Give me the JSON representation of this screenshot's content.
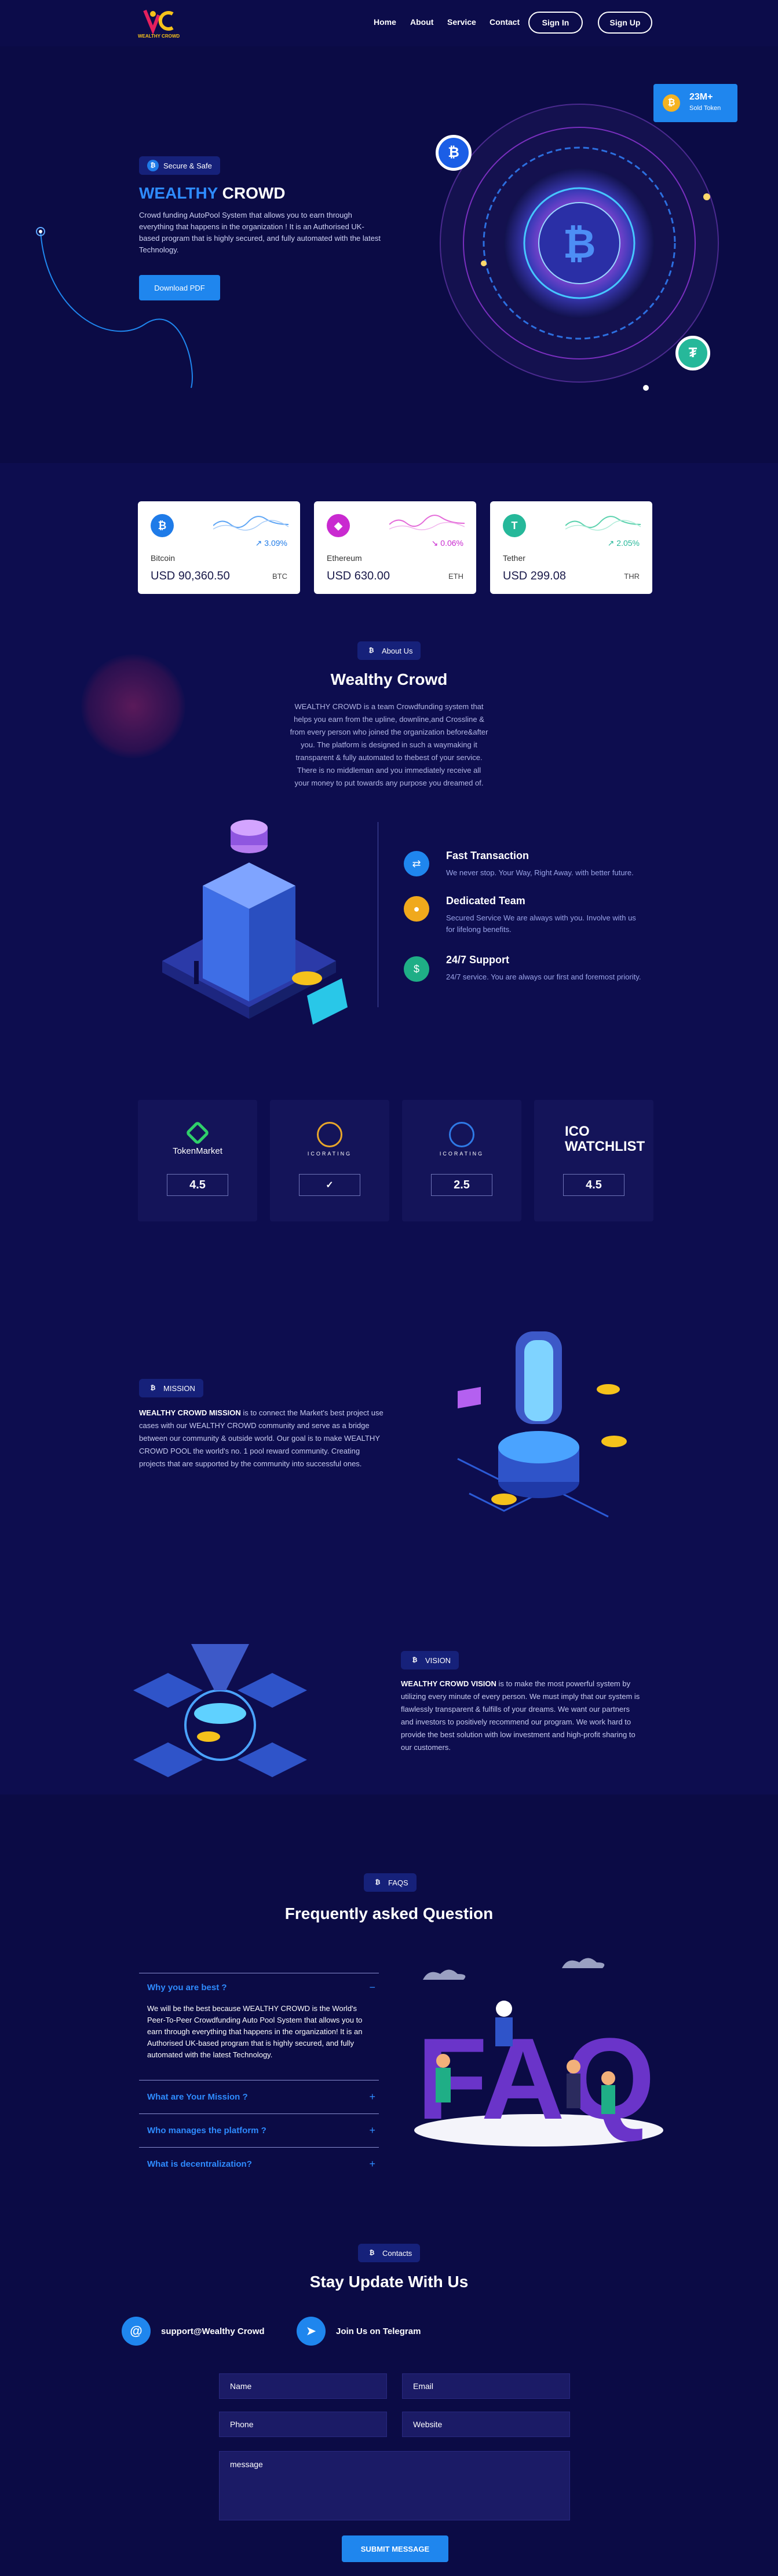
{
  "brand": {
    "logo_text": "WEALTHY CROWD"
  },
  "nav": {
    "links": [
      "Home",
      "About",
      "Service",
      "Contact"
    ],
    "signin": "Sign In",
    "signup": "Sign Up"
  },
  "hero": {
    "badge": "Secure & Safe",
    "title_accent": "WEALTHY",
    "title_rest": "CROWD",
    "description": "Crowd funding AutoPool System that allows you to earn through everything that happens in the organization ! It is an Authorised UK-based program that is highly secured, and fully automated with the latest Technology.",
    "download_button": "Download PDF",
    "sold_badge_value": "23M+",
    "sold_badge_label": "Sold Token"
  },
  "tickers": [
    {
      "name": "Bitcoin",
      "price": "USD 90,360.50",
      "symbol": "BTC",
      "change": "3.09%",
      "color": "#1f7be8",
      "glyph": "₿"
    },
    {
      "name": "Ethereum",
      "price": "USD 630.00",
      "symbol": "ETH",
      "change": "0.06%",
      "color": "#c92ad0",
      "glyph": "◆"
    },
    {
      "name": "Tether",
      "price": "USD 299.08",
      "symbol": "THR",
      "change": "2.05%",
      "color": "#26b89a",
      "glyph": "T"
    }
  ],
  "about": {
    "pill": "About Us",
    "title": "Wealthy Crowd",
    "text": "WEALTHY CROWD is a team Crowdfunding system that helps you earn from the upline, downline,and Crossline & from every person who joined the organization before&after you. The platform is designed in such a waymaking it transparent & fully automated to thebest of your service. There is no middleman and you immediately receive all your money to put towards any purpose you dreamed of."
  },
  "features": [
    {
      "title": "Fast Transaction",
      "desc": "We never stop. Your Way, Right Away. with better future.",
      "color": "#1f86ee",
      "icon": "exchange-icon"
    },
    {
      "title": "Dedicated Team",
      "desc": "Secured Service We are always with you. Involve with us for lifelong benefits.",
      "color": "#f0a91c",
      "icon": "team-icon"
    },
    {
      "title": "24/7 Support",
      "desc": "24/7 service. You are always our first and foremost priority.",
      "color": "#1fae86",
      "icon": "support-icon"
    }
  ],
  "ratings": [
    {
      "logo": "TokenMarket",
      "value": "4.5"
    },
    {
      "logo": "ICORATING",
      "value": "✓"
    },
    {
      "logo": "ICORATING",
      "value": "2.5"
    },
    {
      "logo": "ICO WATCHLIST",
      "value": "4.5"
    }
  ],
  "mission": {
    "pill": "MISSION",
    "lead": "WEALTHY CROWD MISSION",
    "text": " is to connect the Market's best project use cases with our WEALTHY CROWD community and serve as a bridge between our community & outside world. Our goal is to make WEALTHY CROWD POOL the world's no. 1 pool reward community. Creating projects that are supported by the community into successful ones."
  },
  "vision": {
    "pill": "VISION",
    "lead": "WEALTHY CROWD VISION",
    "text": " is to make the most powerful system by utilizing every minute of every person. We must imply that our system is flawlessly transparent & fulfills of your dreams. We want our partners and investors to positively recommend our program. We work hard to provide the best solution with low investment and high-profit sharing to our customers."
  },
  "faq": {
    "pill": "FAQS",
    "title": "Frequently asked Question",
    "items": [
      {
        "q": "Why you are best ?",
        "a": "We will be the best because WEALTHY CROWD is the World's Peer-To-Peer Crowdfunding Auto Pool System that allows you to earn through everything that happens in the organization! It is an Authorised UK-based program that is highly secured, and fully automated with the latest Technology.",
        "toggle": "−"
      },
      {
        "q": "What are Your Mission ?",
        "toggle": "+"
      },
      {
        "q": "Who manages the platform ?",
        "toggle": "+"
      },
      {
        "q": "What is decentralization?",
        "toggle": "+"
      }
    ]
  },
  "contact": {
    "pill": "Contacts",
    "title": "Stay Update With Us",
    "email": "support@Wealthy Crowd",
    "telegram": "Join Us on Telegram",
    "name_ph": "Name",
    "email_ph": "Email",
    "phone_ph": "Phone",
    "website_ph": "Website",
    "message_ph": "message",
    "submit": "SUBMIT MESSAGE"
  }
}
